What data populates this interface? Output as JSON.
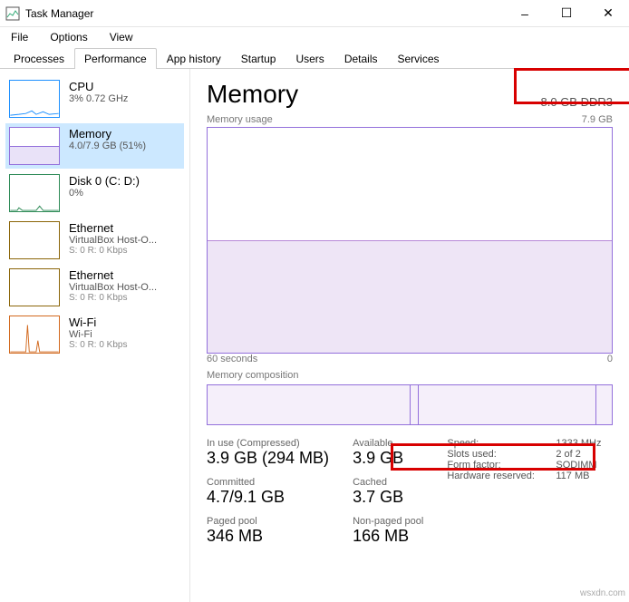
{
  "window": {
    "title": "Task Manager",
    "minimize": "–",
    "maximize": "☐",
    "close": "✕"
  },
  "menu": {
    "file": "File",
    "options": "Options",
    "view": "View"
  },
  "tabs": {
    "processes": "Processes",
    "performance": "Performance",
    "app_history": "App history",
    "startup": "Startup",
    "users": "Users",
    "details": "Details",
    "services": "Services"
  },
  "sidebar": [
    {
      "title": "CPU",
      "line1": "3% 0.72 GHz",
      "color": "#1e90ff"
    },
    {
      "title": "Memory",
      "line1": "4.0/7.9 GB (51%)",
      "color": "#9370db"
    },
    {
      "title": "Disk 0 (C: D:)",
      "line1": "0%",
      "color": "#2e8b57"
    },
    {
      "title": "Ethernet",
      "line1": "VirtualBox Host-O...",
      "line2": "S: 0 R: 0 Kbps",
      "color": "#8b6508"
    },
    {
      "title": "Ethernet",
      "line1": "VirtualBox Host-O...",
      "line2": "S: 0 R: 0 Kbps",
      "color": "#8b6508"
    },
    {
      "title": "Wi-Fi",
      "line1": "Wi-Fi",
      "line2": "S: 0 R: 0 Kbps",
      "color": "#d2691e"
    }
  ],
  "main": {
    "title": "Memory",
    "header_right": "8.0 GB DDR3",
    "usage_label": "Memory usage",
    "usage_max": "7.9 GB",
    "xaxis_left": "60 seconds",
    "xaxis_right": "0",
    "composition_label": "Memory composition",
    "stats": {
      "inuse_label": "In use (Compressed)",
      "inuse_value": "3.9 GB (294 MB)",
      "available_label": "Available",
      "available_value": "3.9 GB",
      "committed_label": "Committed",
      "committed_value": "4.7/9.1 GB",
      "cached_label": "Cached",
      "cached_value": "3.7 GB",
      "paged_label": "Paged pool",
      "paged_value": "346 MB",
      "nonpaged_label": "Non-paged pool",
      "nonpaged_value": "166 MB"
    },
    "details": {
      "speed_k": "Speed:",
      "speed_v": "1333 MHz",
      "slots_k": "Slots used:",
      "slots_v": "2 of 2",
      "form_k": "Form factor:",
      "form_v": "SODIMM",
      "hw_k": "Hardware reserved:",
      "hw_v": "117 MB"
    }
  },
  "chart_data": {
    "type": "area",
    "title": "Memory usage",
    "series": [
      {
        "name": "Memory",
        "values": [
          4.0,
          4.0,
          4.0,
          4.0,
          4.0,
          4.0,
          4.0,
          4.0,
          4.0,
          4.0
        ]
      }
    ],
    "x": "60 seconds to 0",
    "ylim": [
      0,
      7.9
    ],
    "ylabel": "GB"
  },
  "watermark": "wsxdn.com"
}
